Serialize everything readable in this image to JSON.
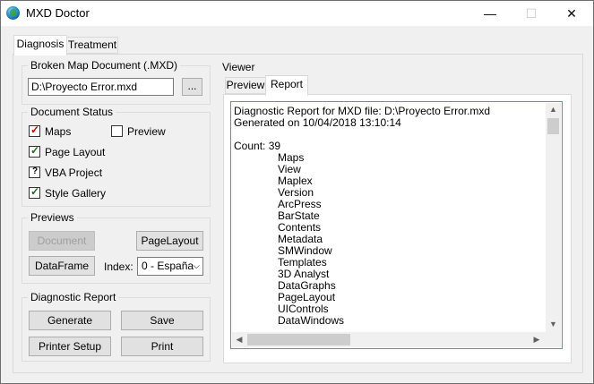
{
  "window": {
    "title": "MXD Doctor",
    "minimize_label": "—",
    "maximize_label": "☐",
    "close_label": "✕"
  },
  "tabs": {
    "diagnosis": "Diagnosis",
    "treatment": "Treatment"
  },
  "broken_doc": {
    "group_label": "Broken Map Document (.MXD)",
    "path_value": "D:\\Proyecto Error.mxd",
    "browse_label": "..."
  },
  "doc_status": {
    "group_label": "Document Status",
    "items": [
      {
        "label": "Maps",
        "state": "checked"
      },
      {
        "label": "Page Layout",
        "state": "checked"
      },
      {
        "label": "VBA Project",
        "state": "unknown"
      },
      {
        "label": "Style Gallery",
        "state": "checked"
      },
      {
        "label": "Preview",
        "state": "unchecked"
      }
    ]
  },
  "previews": {
    "group_label": "Previews",
    "document_label": "Document",
    "pagelayout_label": "PageLayout",
    "dataframe_label": "DataFrame",
    "index_label": "Index:",
    "index_value": "0 - España"
  },
  "diagnostic_report": {
    "group_label": "Diagnostic Report",
    "generate_label": "Generate",
    "save_label": "Save",
    "printer_setup_label": "Printer Setup",
    "print_label": "Print"
  },
  "viewer": {
    "group_label": "Viewer",
    "tab_preview": "Preview",
    "tab_report": "Report",
    "report_lines": [
      "Diagnostic Report for MXD file: D:\\Proyecto Error.mxd",
      "Generated on 10/04/2018 13:10:14",
      "",
      "Count: 39"
    ],
    "report_items": [
      "Maps",
      "View",
      "Maplex",
      "Version",
      "ArcPress",
      "BarState",
      "Contents",
      "Metadata",
      "SMWindow",
      "Templates",
      "3D Analyst",
      "DataGraphs",
      "PageLayout",
      "UIControls",
      "DataWindows"
    ]
  },
  "icons": {
    "checkmark": "✓",
    "unknown": "?",
    "dropdown": "⌵",
    "up": "▲",
    "down": "▼",
    "left": "◀",
    "right": "▶"
  }
}
